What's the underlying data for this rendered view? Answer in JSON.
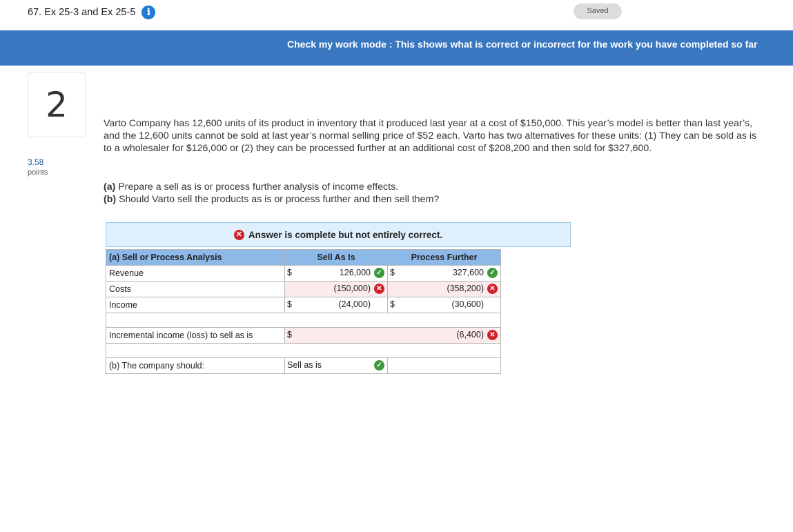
{
  "header": {
    "question_title": "67. Ex 25-3 and Ex 25-5",
    "saved_label": "Saved"
  },
  "banner": {
    "text": "Check my work mode : This shows what is correct or incorrect for the work you have completed so far"
  },
  "question": {
    "number": "2",
    "points_value": "3.58",
    "points_label": "points",
    "problem_text": "Varto Company has 12,600 units of its product in inventory that it produced last year at a cost of $150,000. This year’s model is better than last year’s, and the 12,600 units cannot be sold at last year’s normal selling price of $52 each. Varto has two alternatives for these units: (1) They can be sold as is to a wholesaler for $126,000 or (2) they can be processed further at an additional cost of $208,200 and then sold for $327,600.",
    "task_a_label": "(a)",
    "task_a_text": " Prepare a sell as is or process further analysis of income effects.",
    "task_b_label": "(b)",
    "task_b_text": " Should Varto sell the products as is or process further and then sell them?"
  },
  "answer_status": "Answer is complete but not entirely correct.",
  "table": {
    "headers": [
      "(a) Sell or Process Analysis",
      "Sell As Is",
      "Process Further"
    ],
    "currency": "$",
    "rows": [
      {
        "label": "Revenue",
        "sell": "126,000",
        "sell_status": "correct",
        "process": "327,600",
        "process_status": "correct"
      },
      {
        "label": "Costs",
        "sell": "(150,000)",
        "sell_status": "incorrect",
        "process": "(358,200)",
        "process_status": "incorrect"
      },
      {
        "label": "Income",
        "sell": "(24,000)",
        "process": "(30,600)"
      }
    ],
    "incremental_label": "Incremental income (loss) to sell as is",
    "incremental_value": "(6,400)",
    "incremental_status": "incorrect",
    "part_b_label": "(b) The company should:",
    "part_b_answer": "Sell as is",
    "part_b_status": "correct"
  },
  "icons": {
    "info": "info-icon",
    "correct": "check-circle-icon",
    "incorrect": "x-circle-icon"
  },
  "colors": {
    "banner_bg": "#3a77c1",
    "header_row_bg": "#8cb9e8",
    "correct": "#3c9a3a",
    "incorrect": "#d0202a",
    "input_bg": "#fcebec"
  }
}
